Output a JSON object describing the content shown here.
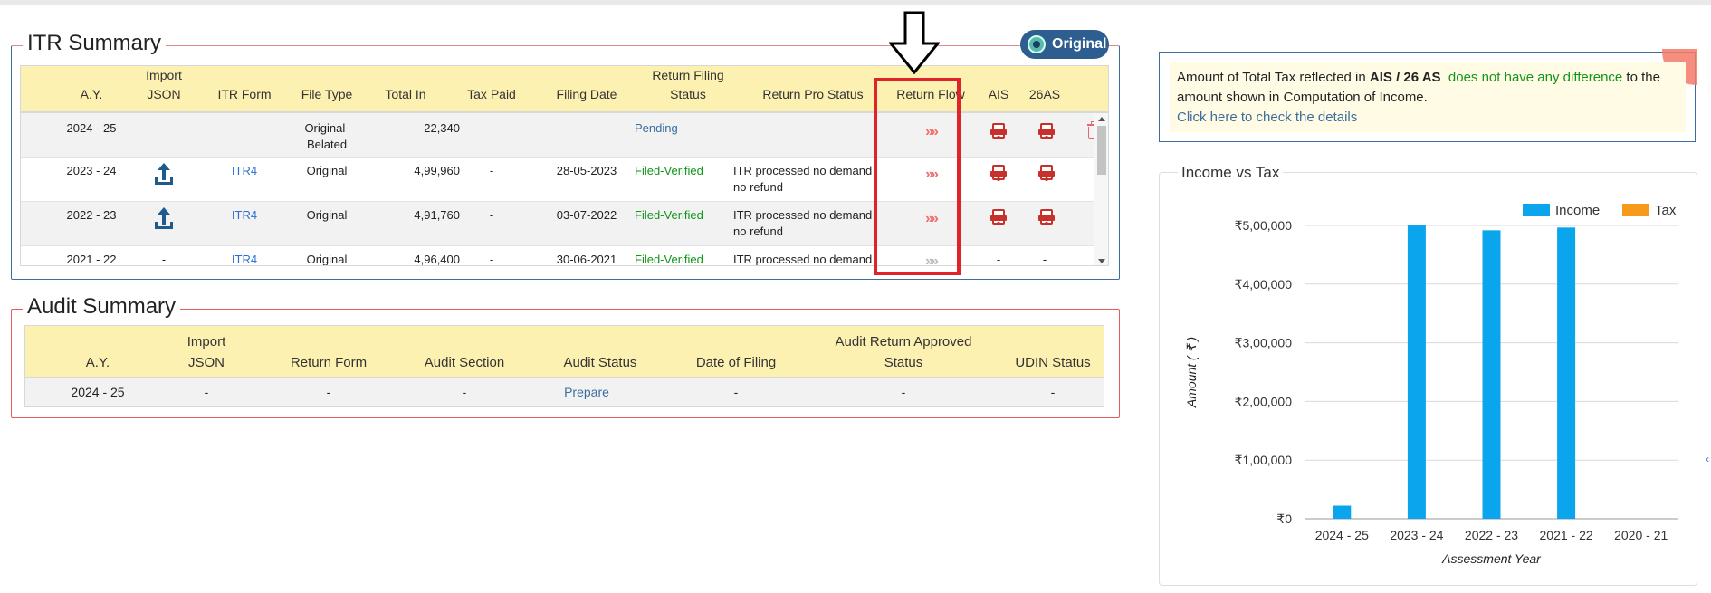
{
  "itr_summary": {
    "title": "ITR Summary",
    "badge": "Original",
    "columns": [
      "A.Y.",
      "Import JSON",
      "ITR Form",
      "File Type",
      "Total In",
      "Tax Paid",
      "Filing Date",
      "Return Filing Status",
      "Return Pro Status",
      "Return Flow",
      "AIS",
      "26AS"
    ],
    "header": {
      "ay": "A.Y.",
      "import_l1": "Import",
      "import_l2": "JSON",
      "itr_form": "ITR Form",
      "file_type": "File Type",
      "total_in": "Total In",
      "tax_paid": "Tax Paid",
      "filing_date": "Filing Date",
      "rfs_l1": "Return Filing",
      "rfs_l2": "Status",
      "return_pro_status": "Return Pro Status",
      "return_flow": "Return Flow",
      "ais": "AIS",
      "as26": "26AS"
    },
    "rows": [
      {
        "ay": "2024 - 25",
        "import_json": "-",
        "itr_form": "-",
        "file_type_l1": "Original-",
        "file_type_l2": "Belated",
        "total_in": "22,340",
        "tax_paid": "-",
        "filing_date": "-",
        "filing_status": "Pending",
        "pro_status_l1": "-",
        "pro_status_l2": "",
        "flow": "»»",
        "ais": "pdf-icon",
        "as26": "pdf-icon",
        "action": "trash-icon"
      },
      {
        "ay": "2023 - 24",
        "import_json": "upload-icon",
        "itr_form": "ITR4",
        "file_type_l1": "Original",
        "file_type_l2": "",
        "total_in": "4,99,960",
        "tax_paid": "-",
        "filing_date": "28-05-2023",
        "filing_status": "Filed-Verified",
        "pro_status_l1": "ITR processed no demand",
        "pro_status_l2": "no refund",
        "flow": "»»",
        "ais": "pdf-icon",
        "as26": "pdf-icon"
      },
      {
        "ay": "2022 - 23",
        "import_json": "upload-icon",
        "itr_form": "ITR4",
        "file_type_l1": "Original",
        "file_type_l2": "",
        "total_in": "4,91,760",
        "tax_paid": "-",
        "filing_date": "03-07-2022",
        "filing_status": "Filed-Verified",
        "pro_status_l1": "ITR processed no demand",
        "pro_status_l2": "no refund",
        "flow": "»»",
        "ais": "pdf-icon",
        "as26": "pdf-icon"
      },
      {
        "ay": "2021 - 22",
        "import_json": "-",
        "itr_form": "ITR4",
        "file_type_l1": "Original",
        "file_type_l2": "",
        "total_in": "4,96,400",
        "tax_paid": "-",
        "filing_date": "30-06-2021",
        "filing_status": "Filed-Verified",
        "pro_status_l1": "ITR processed no demand",
        "pro_status_l2": "",
        "flow": "»»",
        "ais": "-",
        "as26": "-"
      }
    ]
  },
  "audit_summary": {
    "title": "Audit Summary",
    "header": {
      "ay": "A.Y.",
      "import_l1": "Import",
      "import_l2": "JSON",
      "return_form": "Return Form",
      "audit_section": "Audit Section",
      "audit_status": "Audit Status",
      "date_of_filing": "Date of Filing",
      "approved_l1": "Audit Return Approved",
      "approved_l2": "Status",
      "udin_status": "UDIN Status"
    },
    "rows": [
      {
        "ay": "2024 - 25",
        "import_json": "-",
        "return_form": "-",
        "audit_section": "-",
        "audit_status": "Prepare",
        "date_of_filing": "-",
        "approved_status": "-",
        "udin_status": "-"
      }
    ]
  },
  "ais_notice": {
    "text_1": "Amount of Total Tax reflected in ",
    "bold": "AIS / 26 AS",
    "highlight": "does not have any difference",
    "text_2": " to the amount shown in Computation of Income.",
    "link": "Click here to check the details"
  },
  "chart_data": {
    "type": "bar",
    "title": "Income vs Tax",
    "xlabel": "Assessment Year",
    "ylabel": "Amount ( ₹ )",
    "categories": [
      "2024 - 25",
      "2023 - 24",
      "2022 - 23",
      "2021 - 22",
      "2020 - 21"
    ],
    "series": [
      {
        "name": "Income",
        "color": "#0aa5ec",
        "values": [
          22340,
          499960,
          491760,
          496400,
          0
        ]
      },
      {
        "name": "Tax",
        "color": "#f79a1b",
        "values": [
          0,
          0,
          0,
          0,
          0
        ]
      }
    ],
    "ylim": [
      0,
      500000
    ],
    "yticks": [
      0,
      100000,
      200000,
      300000,
      400000,
      500000
    ],
    "ytick_labels": [
      "₹0",
      "₹1,00,000",
      "₹2,00,000",
      "₹3,00,000",
      "₹4,00,000",
      "₹5,00,000"
    ],
    "legend": "top-right",
    "grid": true
  }
}
